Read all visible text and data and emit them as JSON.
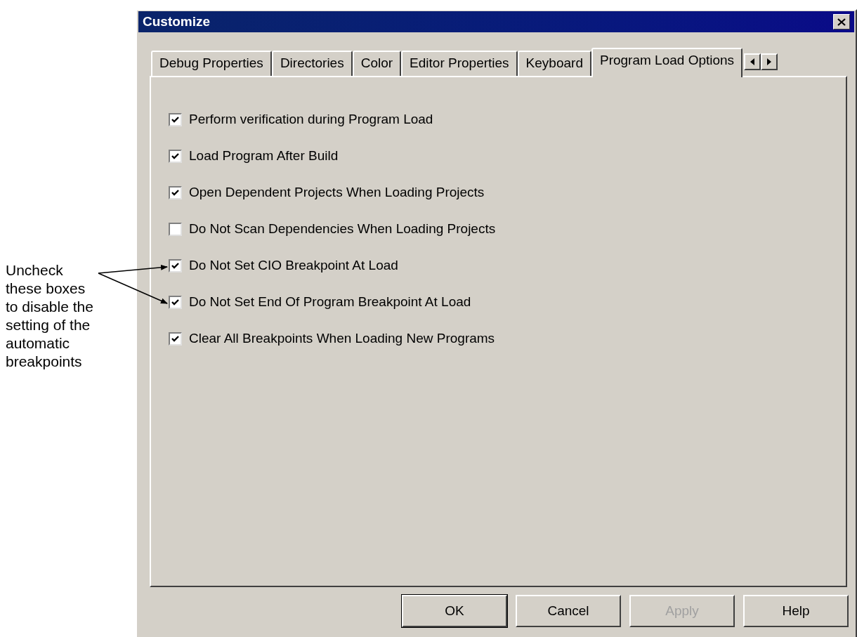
{
  "annotation": {
    "text": "Uncheck\nthese boxes\nto disable the\nsetting of the\nautomatic\nbreakpoints"
  },
  "window": {
    "title": "Customize"
  },
  "tabs": [
    {
      "label": "Debug Properties",
      "selected": false
    },
    {
      "label": "Directories",
      "selected": false
    },
    {
      "label": "Color",
      "selected": false
    },
    {
      "label": "Editor Properties",
      "selected": false
    },
    {
      "label": "Keyboard",
      "selected": false
    },
    {
      "label": "Program Load Options",
      "selected": true
    }
  ],
  "options": [
    {
      "label": "Perform verification during Program Load",
      "checked": true
    },
    {
      "label": "Load Program After Build",
      "checked": true
    },
    {
      "label": "Open Dependent Projects When Loading Projects",
      "checked": true
    },
    {
      "label": "Do Not Scan Dependencies When Loading Projects",
      "checked": false
    },
    {
      "label": "Do Not Set CIO Breakpoint At Load",
      "checked": true,
      "annotated": true
    },
    {
      "label": "Do Not Set End Of Program Breakpoint At Load",
      "checked": true,
      "annotated": true
    },
    {
      "label": "Clear All Breakpoints When Loading New Programs",
      "checked": true
    }
  ],
  "buttons": [
    {
      "label": "OK",
      "default": true,
      "disabled": false
    },
    {
      "label": "Cancel",
      "default": false,
      "disabled": false
    },
    {
      "label": "Apply",
      "default": false,
      "disabled": true
    },
    {
      "label": "Help",
      "default": false,
      "disabled": false
    }
  ]
}
